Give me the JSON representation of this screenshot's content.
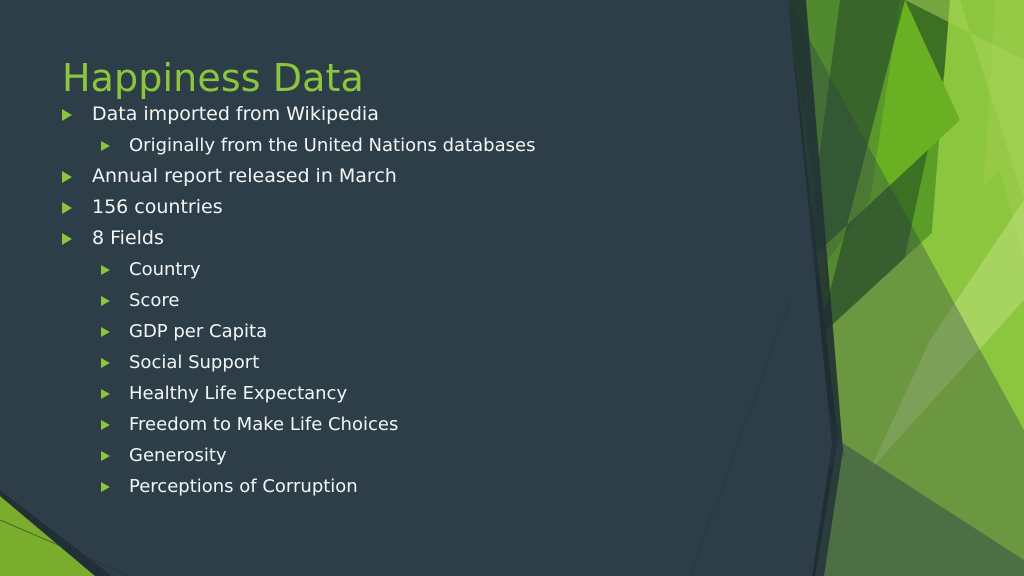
{
  "slide": {
    "title": "Happiness Data",
    "theme": {
      "background_color": "#2d3e48",
      "title_color": "#8cc63e",
      "body_text_color": "#f2f5f6",
      "bullet_marker_color": "#8cc63e",
      "accent_green_dark": "#3c7022",
      "accent_green_mid": "#5a9e28",
      "accent_green_bright": "#70a82a",
      "accent_green_light": "#8cc63e",
      "accent_green_pale": "#a8d45a"
    },
    "bullet_marker_icon": "triangle-right-icon",
    "bullets": [
      {
        "level": 1,
        "text": "Data imported from Wikipedia"
      },
      {
        "level": 2,
        "text": "Originally from the United Nations databases"
      },
      {
        "level": 1,
        "text": "Annual report released in March"
      },
      {
        "level": 1,
        "text": "156 countries"
      },
      {
        "level": 1,
        "text": "8 Fields"
      },
      {
        "level": 2,
        "text": "Country"
      },
      {
        "level": 2,
        "text": "Score"
      },
      {
        "level": 2,
        "text": "GDP per Capita"
      },
      {
        "level": 2,
        "text": "Social Support"
      },
      {
        "level": 2,
        "text": "Healthy Life Expectancy"
      },
      {
        "level": 2,
        "text": "Freedom to Make Life Choices"
      },
      {
        "level": 2,
        "text": "Generosity"
      },
      {
        "level": 2,
        "text": "Perceptions of Corruption"
      }
    ]
  }
}
